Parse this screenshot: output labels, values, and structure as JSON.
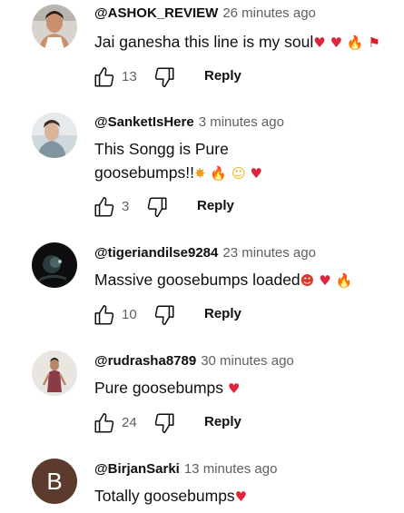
{
  "comments": [
    {
      "author": "@ASHOK_REVIEW",
      "time": "26 minutes ago",
      "text": "Jai ganesha this line is my soul",
      "emoji": [
        "heart",
        "heart",
        "fire",
        "flag"
      ],
      "likes": "13",
      "reply_label": "Reply"
    },
    {
      "author": "@SanketIsHere",
      "time": "3 minutes ago",
      "text_line1": "This Songg is Pure",
      "text_line2": "goosebumps!!",
      "emoji": [
        "collision",
        "fire",
        "star-struck",
        "heart"
      ],
      "likes": "3",
      "reply_label": "Reply"
    },
    {
      "author": "@tigeriandilse9284",
      "time": "23 minutes ago",
      "text": "Massive goosebumps loaded",
      "emoji": [
        "hot-face",
        "heart",
        "fire"
      ],
      "likes": "10",
      "reply_label": "Reply"
    },
    {
      "author": "@rudrasha8789",
      "time": "30 minutes ago",
      "text": "Pure goosebumps",
      "emoji": [
        "heart"
      ],
      "likes": "24",
      "reply_label": "Reply"
    },
    {
      "author": "@BirjanSarki",
      "time": "13 minutes ago",
      "avatar_letter": "B",
      "avatar_color": "#5d3a2e",
      "text": "Totally goosebumps",
      "emoji": [
        "heart"
      ]
    }
  ],
  "glyphs": {
    "heart": "♥",
    "fire": "🔥",
    "flag": "⚑",
    "collision": "✸",
    "star-struck": "☺",
    "hot-face": "☻"
  },
  "colors": {
    "heart": "#e0243b",
    "fire": "#f26b1d",
    "author": "#0f0f0f",
    "meta": "#606060"
  }
}
